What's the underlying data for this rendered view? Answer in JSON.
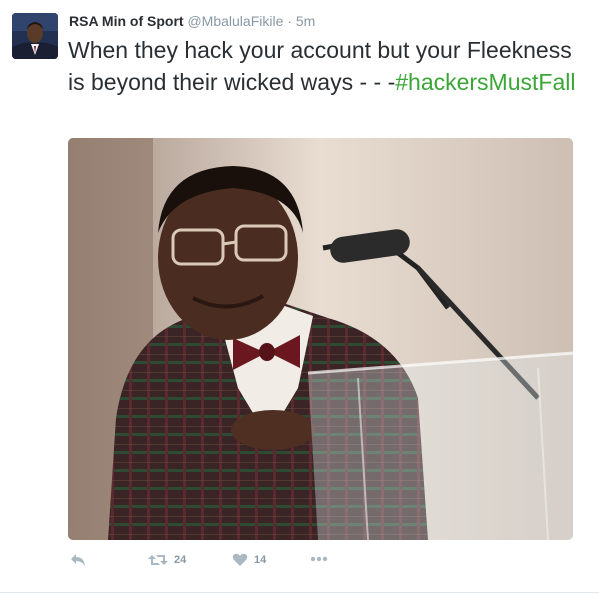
{
  "tweet": {
    "fullname": "RSA Min of Sport",
    "username": "@MbalulaFikile",
    "separator": "·",
    "time": "5m",
    "text_main": "When they hack your account but your Fleekness is beyond their wicked ways - - -",
    "hashtag": "#hackersMustFall",
    "retweets": "24",
    "likes": "14"
  },
  "icons": {
    "reply": "reply-icon",
    "retweet": "retweet-icon",
    "like": "heart-icon",
    "more": "more-icon"
  },
  "colors": {
    "hashtag": "#39a635",
    "text": "#292f33",
    "muted": "#8899a6",
    "icon": "#aab8c2"
  }
}
